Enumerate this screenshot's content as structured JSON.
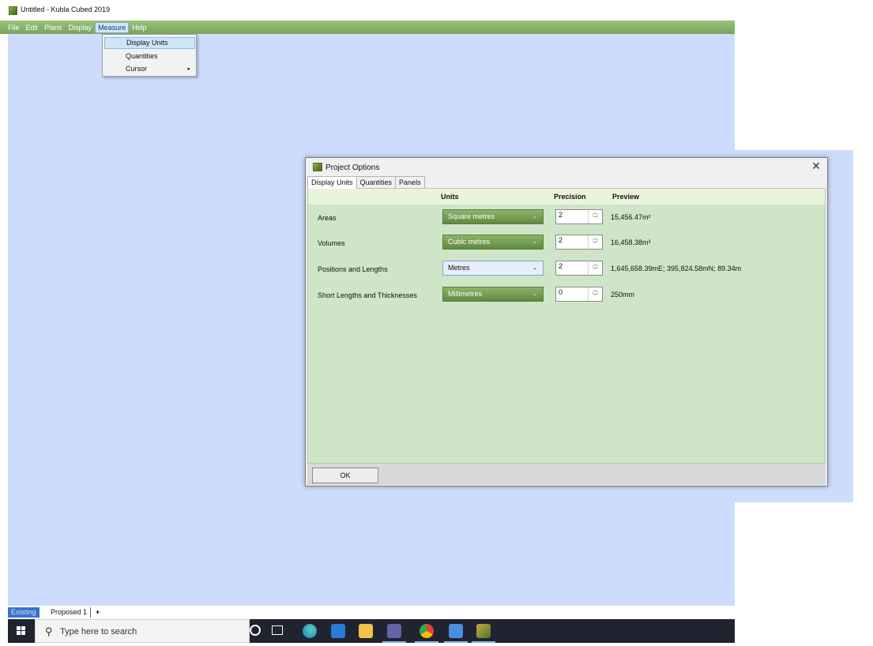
{
  "window": {
    "title": "Untitled - Kubla Cubed 2019"
  },
  "menubar": {
    "items": [
      "File",
      "Edit",
      "Plans",
      "Display",
      "Measure",
      "Help"
    ],
    "active": "Measure"
  },
  "measure_menu": {
    "items": [
      "Display Units",
      "Quantities",
      "Cursor"
    ],
    "highlighted": "Display Units",
    "submenu_arrow": "▸"
  },
  "dialog": {
    "title": "Project Options",
    "close": "✕",
    "tabs": [
      "Display Units",
      "Quantities",
      "Panels"
    ],
    "active_tab": "Display Units",
    "headers": {
      "units": "Units",
      "precision": "Precision",
      "preview": "Preview"
    },
    "rows": [
      {
        "label": "Areas",
        "unit": "Square metres",
        "precision": "2",
        "preview": "15,456.47m²"
      },
      {
        "label": "Volumes",
        "unit": "Cubic metres",
        "precision": "2",
        "preview": "16,458.38m³"
      },
      {
        "label": "Positions and Lengths",
        "unit": "Metres",
        "precision": "2",
        "preview": "1,645,658.39mE; 395,824.58mN; 89.34m"
      },
      {
        "label": "Short Lengths and Thicknesses",
        "unit": "Millimetres",
        "precision": "0",
        "preview": "250mm"
      }
    ],
    "ok_label": "OK"
  },
  "layers": {
    "existing": "Existing",
    "proposed": "Proposed 1",
    "add": "+"
  },
  "taskbar": {
    "search_placeholder": "Type here to search",
    "icons": [
      "cortana-icon",
      "task-view-icon",
      "edge-icon",
      "mail-icon",
      "file-explorer-icon",
      "teams-icon",
      "chrome-icon",
      "notepad-icon",
      "kubla-icon"
    ]
  },
  "colors": {
    "canvas": "#cddcfc",
    "menubar": "#8cb46a",
    "panel": "#cfe5c7",
    "accent": "#3a73c9"
  }
}
